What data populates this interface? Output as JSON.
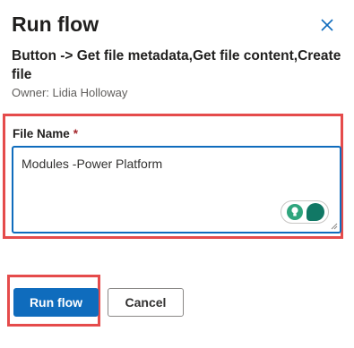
{
  "dialog": {
    "title": "Run flow",
    "subtitle": "Button -> Get file metadata,Get file content,Create file",
    "owner": "Owner: Lidia Holloway"
  },
  "form": {
    "field_label": "File Name",
    "required_marker": "*",
    "field_value": "Modules -Power Platform"
  },
  "actions": {
    "run_label": "Run flow",
    "cancel_label": "Cancel"
  },
  "icons": {
    "close": "close-icon",
    "suggestion": "lightbulb-icon",
    "copilot": "copilot-chat-icon",
    "resize": "resize-handle-icon"
  },
  "colors": {
    "accent": "#0f6cbd",
    "highlight": "#e54b4b",
    "required": "#a4262c"
  }
}
